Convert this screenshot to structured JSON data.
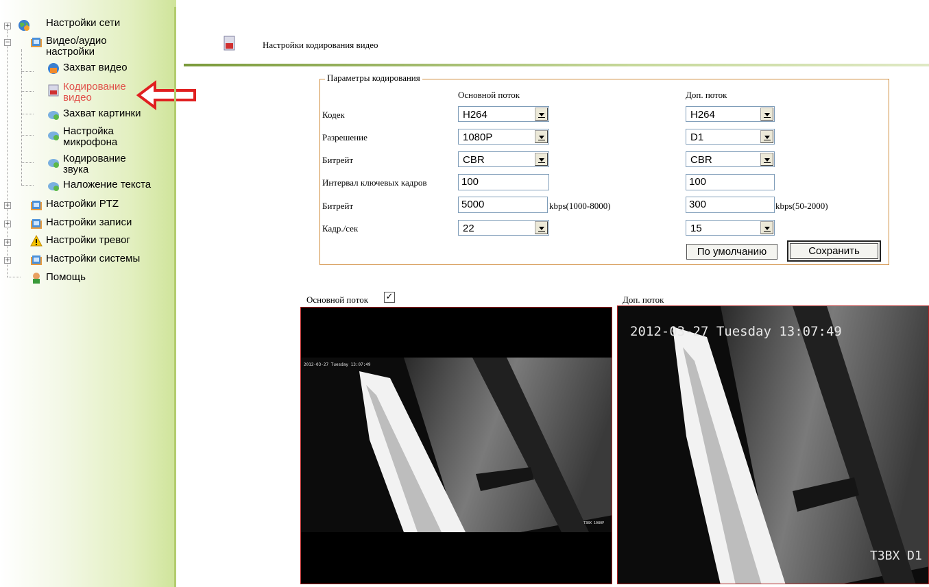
{
  "sidebar": {
    "items": [
      {
        "label": "Настройки сети",
        "expander": "+",
        "icon": "network-globe-icon"
      },
      {
        "label": "Видео/аудио",
        "label2": "настройки",
        "expander": "−",
        "icon": "folder-icon"
      },
      {
        "label": "Захват видео",
        "icon": "video-capture-icon"
      },
      {
        "label": "Кодирование",
        "label2": "видео",
        "icon": "document-icon",
        "active": true
      },
      {
        "label": "Захват картинки",
        "icon": "picture-capture-icon"
      },
      {
        "label": "Настройка",
        "label2": "микрофона",
        "icon": "microphone-icon"
      },
      {
        "label": "Кодирование",
        "label2": "звука",
        "icon": "audio-icon"
      },
      {
        "label": "Наложение текста",
        "icon": "text-overlay-icon"
      },
      {
        "label": "Настройки PTZ",
        "expander": "+",
        "icon": "folder-icon"
      },
      {
        "label": "Настройки записи",
        "expander": "+",
        "icon": "folder-icon"
      },
      {
        "label": "Настройки тревог",
        "expander": "+",
        "icon": "warning-icon"
      },
      {
        "label": "Настройки системы",
        "expander": "+",
        "icon": "folder-icon"
      },
      {
        "label": "Помощь",
        "icon": "help-icon"
      }
    ],
    "pointer": "red-arrow-icon"
  },
  "header": {
    "title": "Настройки кодирования видео",
    "icon": "document-icon"
  },
  "encoding": {
    "legend": "Параметры кодирования",
    "main_header": "Основной поток",
    "sub_header": "Доп. поток",
    "rows": {
      "codec": {
        "label": "Кодек",
        "main": "H264",
        "sub": "H264"
      },
      "resolution": {
        "label": "Разрешение",
        "main": "1080P",
        "sub": "D1"
      },
      "bitrate_mode": {
        "label": "Битрейт",
        "main": "CBR",
        "sub": "CBR"
      },
      "keyframe": {
        "label": "Интервал ключевых кадров",
        "main": "100",
        "sub": "100"
      },
      "bitrate": {
        "label": "Битрейт",
        "main": "5000",
        "main_hint": "kbps(1000-8000)",
        "sub": "300",
        "sub_hint": "kbps(50-2000)"
      },
      "fps": {
        "label": "Кадр./сек",
        "main": "22",
        "sub": "15"
      }
    },
    "default_button": "По умолчанию",
    "save_button": "Сохранить"
  },
  "preview": {
    "main_label": "Основной поток",
    "main_checked": "✓",
    "sub_label": "Доп. поток",
    "main_osd_time": "2012-03-27 Tuesday 13:07:49",
    "main_osd_name": "T3BX 1080P",
    "sub_osd_time": "2012-03-27 Tuesday 13:07:49",
    "sub_osd_name": "T3BX D1"
  },
  "colors": {
    "active": "#e0504a",
    "fieldset_border": "#d08c3c",
    "video_border": "#b22222",
    "sidebar_green": "#cfe49a"
  }
}
